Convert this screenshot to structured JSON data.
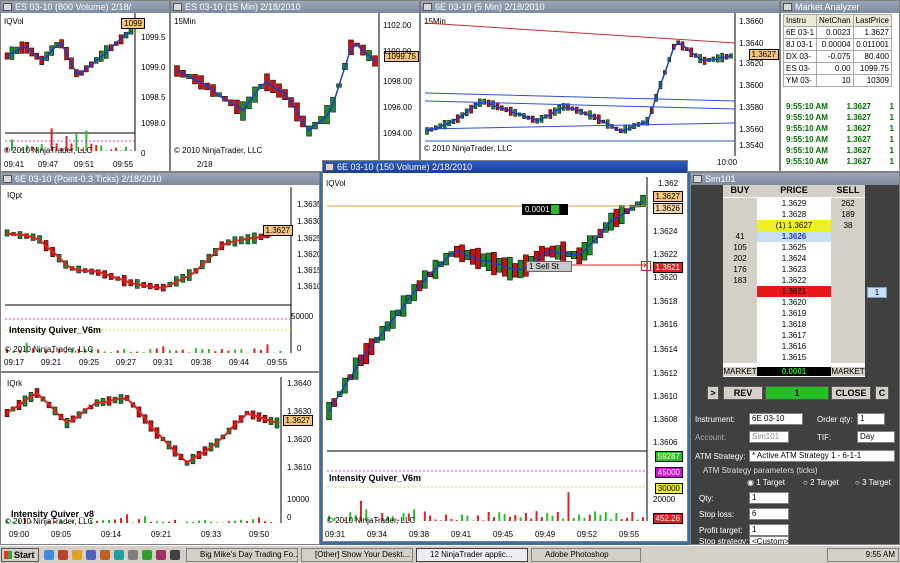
{
  "windows": {
    "w1": {
      "title": "ES 03-10 (800 Volume) 2/18/",
      "subtitle": "IQVol",
      "price_label": "1099",
      "yticks": [
        "1099.5",
        "1099.0",
        "1098.5",
        "1098.0",
        "0"
      ],
      "xticks": [
        "09:41",
        "09:47",
        "09:51",
        "09:55"
      ],
      "copyright": "© 2010 NinjaTrader, LLC"
    },
    "w2": {
      "title": "ES 03-10 (15 Min) 2/18/2010",
      "subtitle": "15Min",
      "price_label": "1099.75",
      "yticks": [
        "1102.00",
        "1100.00",
        "1098.00",
        "1096.00",
        "1094.00"
      ],
      "xticks": [
        "2/18"
      ],
      "copyright": "© 2010 NinjaTrader, LLC"
    },
    "w3": {
      "title": "6E 03-10 (5 Min) 2/18/2010",
      "subtitle": "15Min",
      "price_label": "1.3627",
      "yticks": [
        "1.3660",
        "1.3640",
        "1.3620",
        "1.3600",
        "1.3580",
        "1.3560",
        "1.3540"
      ],
      "xticks": [
        "10:00"
      ],
      "copyright": "© 2010 NinjaTrader, LLC"
    },
    "w4": {
      "title": "6E 03-10 (Point-0.3 Ticks) 2/18/2010",
      "subtitle": "IQpt",
      "price_label": "1.3627",
      "yticks": [
        "1.3635",
        "1.3630",
        "1.3625",
        "1.3620",
        "1.3615",
        "1.3610",
        "50000",
        "0"
      ],
      "xticks": [
        "09:17",
        "09:21",
        "09:25",
        "09:27",
        "09:31",
        "09:38",
        "09:44",
        "09:55"
      ],
      "indicator": "Intensity Quiver_V6m",
      "copyright": "© 2010 NinjaTrader, LLC"
    },
    "w5": {
      "title": "",
      "subtitle": "IQrk",
      "price_label": "1.3627",
      "yticks": [
        "1.3640",
        "1.3630",
        "1.3620",
        "1.3610",
        "10000",
        "0"
      ],
      "xticks": [
        "09:00",
        "09:05",
        "09:14",
        "09:21",
        "09:33",
        "09:50"
      ],
      "indicator": "Intensity Quiver_v8",
      "copyright": "© 2010 NinjaTrader, LLC"
    },
    "w6": {
      "title": "6E 03-10 (150 Volume) 2/18/2010",
      "subtitle": "IQVol",
      "price_labels": {
        "top": "1.3627",
        "second": "1.3626",
        "order": "1.3621",
        "vol1": "59287",
        "vol2": "45000",
        "vol3": "30000",
        "vol4": "452.26"
      },
      "yticks": [
        "1.362",
        "1.3624",
        "1.3622",
        "1.3620",
        "1.3618",
        "1.3616",
        "1.3614",
        "1.3612",
        "1.3610",
        "1.3608",
        "1.3606",
        "20000"
      ],
      "xticks": [
        "09:31",
        "09:34",
        "09:38",
        "09:41",
        "09:45",
        "09:49",
        "09:52",
        "09:55"
      ],
      "indicator": "Intensity Quiver_V6m",
      "order_tag": "1  Sell  St",
      "qty_tag": "0.0001",
      "copyright": "© 2010 NinjaTrader, LLC"
    }
  },
  "market_analyzer": {
    "title": "Market Analyzer",
    "headers": [
      "Instru",
      "NetChan",
      "LastPrice"
    ],
    "rows": [
      [
        "6E 03-1",
        "0.0023",
        "1.3627"
      ],
      [
        "8J 03-1",
        "0.00004",
        "0.011001"
      ],
      [
        "DX 03-",
        "-0.075",
        "80.400"
      ],
      [
        "ES 03-",
        "0.00",
        "1099.75"
      ],
      [
        "YM 03-",
        "10",
        "10309"
      ]
    ],
    "trades": [
      [
        "9:55:10 AM",
        "1.3627",
        "1"
      ],
      [
        "9:55:10 AM",
        "1.3627",
        "1"
      ],
      [
        "9:55:10 AM",
        "1.3627",
        "1"
      ],
      [
        "9:55:10 AM",
        "1.3627",
        "1"
      ],
      [
        "9:55:10 AM",
        "1.3627",
        "1"
      ],
      [
        "9:55:10 AM",
        "1.3627",
        "1"
      ],
      [
        "9:55:10 AM",
        "1.3627",
        "1"
      ],
      [
        "9:55:10 AM",
        "1.3627",
        "1"
      ]
    ]
  },
  "dom": {
    "title": "Sim101",
    "headers": [
      "BUY",
      "PRICE",
      "SELL"
    ],
    "rows": [
      [
        "",
        "1.3629",
        "262"
      ],
      [
        "",
        "1.3628",
        "189"
      ],
      [
        "",
        "(1) 1.3627",
        "38"
      ],
      [
        "41",
        "1.3626",
        ""
      ],
      [
        "105",
        "1.3625",
        ""
      ],
      [
        "202",
        "1.3624",
        ""
      ],
      [
        "176",
        "1.3623",
        ""
      ],
      [
        "183",
        "1.3622",
        ""
      ],
      [
        "",
        "1.3621",
        ""
      ],
      [
        "",
        "1.3620",
        ""
      ],
      [
        "",
        "1.3619",
        ""
      ],
      [
        "",
        "1.3618",
        ""
      ],
      [
        "",
        "1.3617",
        ""
      ],
      [
        "",
        "1.3616",
        ""
      ],
      [
        "",
        "1.3615",
        ""
      ]
    ],
    "side_qty": "1",
    "market_buy": "MARKET",
    "market_pnl": "0.0001",
    "market_sell": "MARKET",
    "rev": "REV",
    "position": "1",
    "close": "CLOSE",
    "left_btn": ">",
    "right_btn": "C",
    "instrument_label": "Instrument:",
    "instrument": "6E 03-10",
    "orderqty_label": "Order qty:",
    "orderqty": "1",
    "account_label": "Account:",
    "account": "Sim101",
    "tif_label": "TIF:",
    "tif": "Day",
    "atm_label": "ATM Strategy:",
    "atm": "* Active ATM Strategy 1 - 6-1-1",
    "atm_params": "ATM Strategy parameters (ticks)",
    "target1": "1 Target",
    "target2": "2 Target",
    "target3": "3 Target",
    "qty_label": "Qty:",
    "qty": "1",
    "stop_label": "Stop loss:",
    "stop": "6",
    "profit_label": "Profit target:",
    "profit": "1",
    "stopstrat_label": "Stop strategy:",
    "stopstrat": "<Custom>"
  },
  "taskbar": {
    "start": "Start",
    "items": [
      "Big Mike's Day Trading Fo...",
      "[Other] Show Your Deskt...",
      "12 NinjaTrader applic...",
      "Adobe Photoshop"
    ],
    "clock": "9:55 AM"
  },
  "colors": {
    "up": "#1a8a2a",
    "down": "#cc1010",
    "ma": "#1a3ccc",
    "accent": "#0a4ac8"
  }
}
